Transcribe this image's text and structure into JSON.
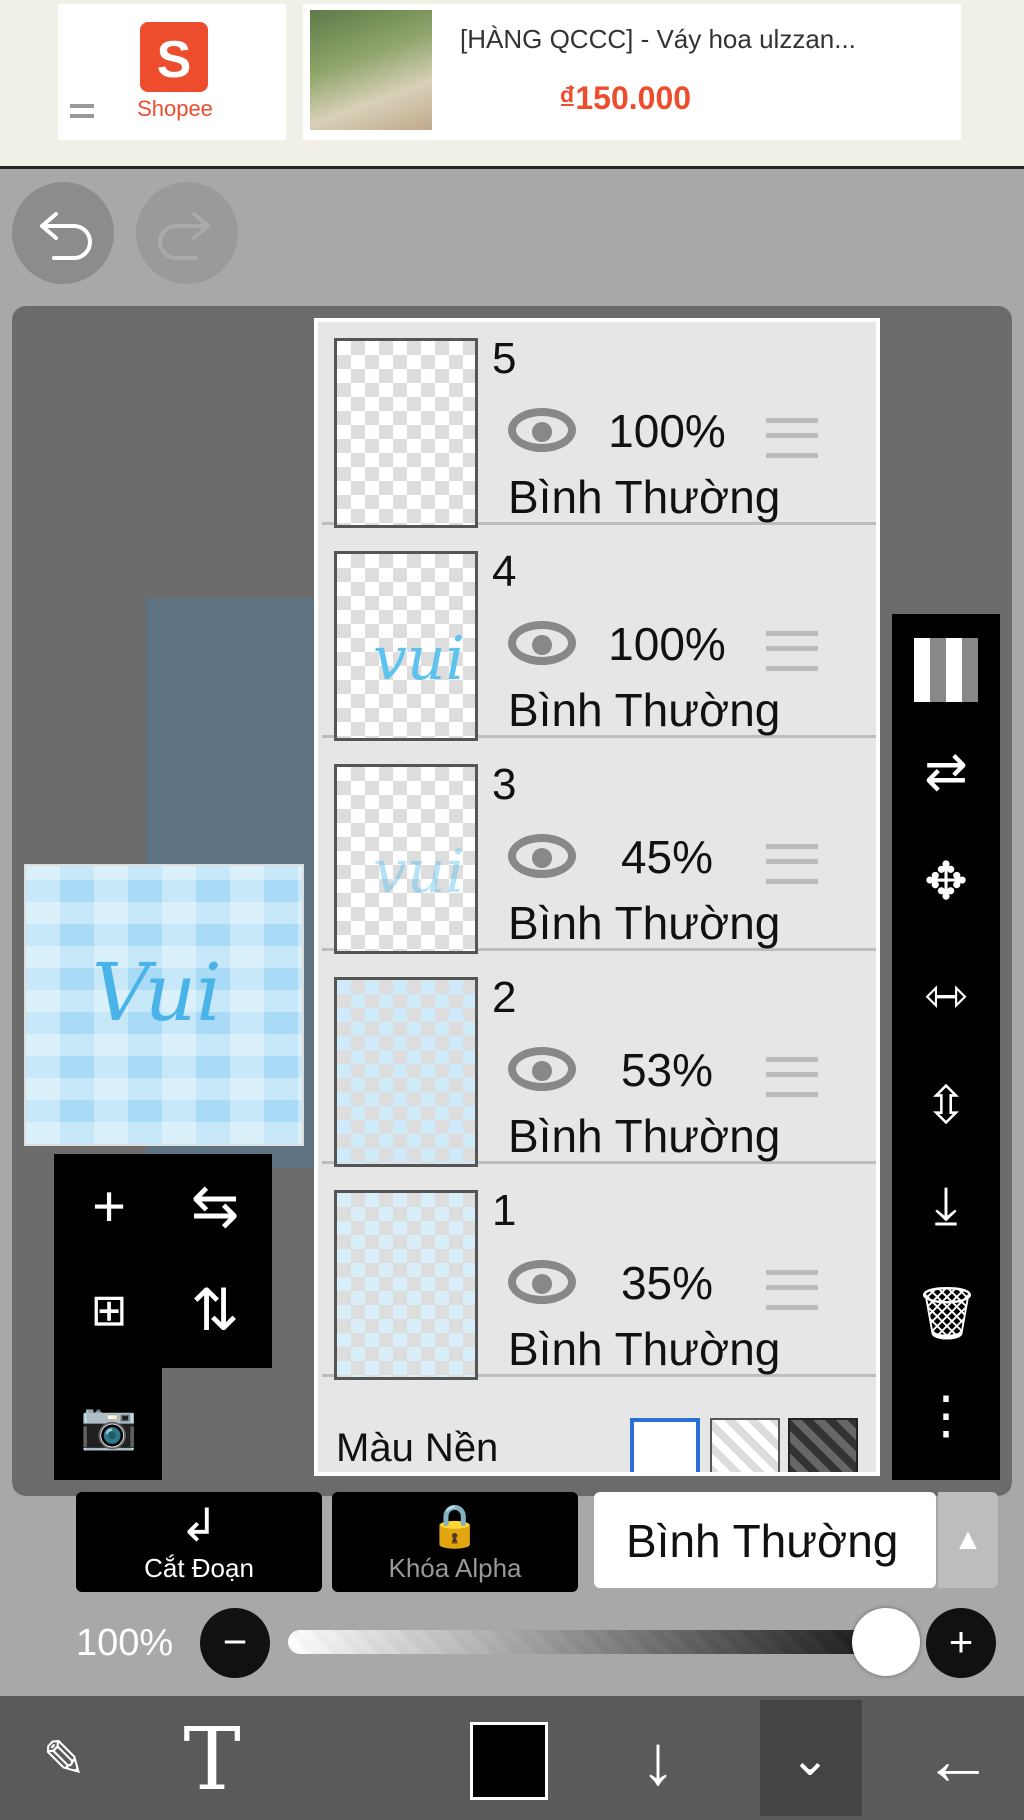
{
  "ad": {
    "logo_text": "Shopee",
    "logo_glyph": "S",
    "product_title": "[HÀNG QCCC] - Váy hoa ulzzan...",
    "price": "₫150.000"
  },
  "layers": [
    {
      "number": "5",
      "opacity": "100%",
      "blend": "Bình Thường"
    },
    {
      "number": "4",
      "opacity": "100%",
      "blend": "Bình Thường"
    },
    {
      "number": "3",
      "opacity": "45%",
      "blend": "Bình Thường"
    },
    {
      "number": "2",
      "opacity": "53%",
      "blend": "Bình Thường"
    },
    {
      "number": "1",
      "opacity": "35%",
      "blend": "Bình Thường"
    }
  ],
  "background_label": "Màu Nền",
  "controls": {
    "clip_label": "Cắt Đoạn",
    "alpha_lock_label": "Khóa Alpha",
    "blend_mode": "Bình Thường",
    "opacity_value": "100%"
  },
  "icons": {
    "undo": "undo-icon",
    "redo": "redo-icon",
    "transparency": "checkerboard-icon",
    "reference": "swap-layer-icon",
    "move": "move-icon",
    "flip_h": "flip-horizontal-icon",
    "flip_v": "flip-vertical-icon",
    "merge_down": "merge-down-icon",
    "delete": "trash-icon",
    "more": "more-vertical-icon"
  },
  "colors": {
    "shopee": "#ee4d2d",
    "active_color": "#000000"
  }
}
